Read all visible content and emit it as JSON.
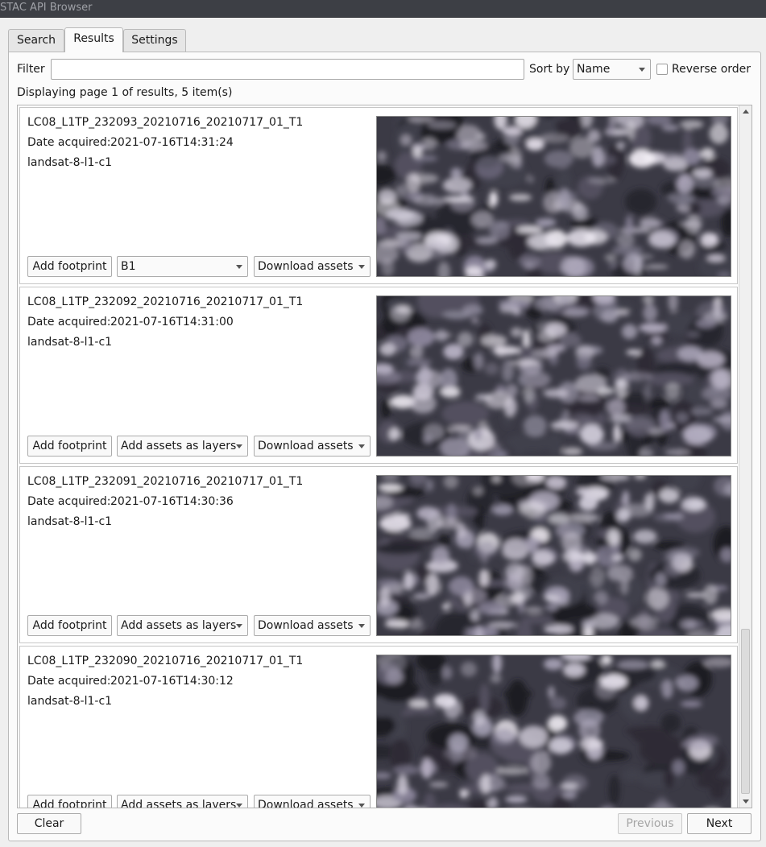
{
  "window": {
    "title": "STAC API Browser"
  },
  "tabs": [
    {
      "label": "Search",
      "active": false
    },
    {
      "label": "Results",
      "active": true
    },
    {
      "label": "Settings",
      "active": false
    }
  ],
  "toolbar": {
    "filter_label": "Filter",
    "filter_value": "",
    "sort_label": "Sort by",
    "sort_value": "Name",
    "reverse_label": "Reverse order",
    "reverse_checked": false
  },
  "status": "Displaying page 1 of results, 5 item(s)",
  "items": [
    {
      "name": "LC08_L1TP_232093_20210716_20210717_01_T1",
      "date_label": "Date acquired:",
      "date": "2021-07-16T14:31:24",
      "collection": "landsat-8-l1-c1",
      "footprint_button": "Add footprint",
      "assets_combo": "B1",
      "download_combo": "Download assets"
    },
    {
      "name": "LC08_L1TP_232092_20210716_20210717_01_T1",
      "date_label": "Date acquired:",
      "date": "2021-07-16T14:31:00",
      "collection": "landsat-8-l1-c1",
      "footprint_button": "Add footprint",
      "assets_combo": "Add assets as layers",
      "download_combo": "Download assets"
    },
    {
      "name": "LC08_L1TP_232091_20210716_20210717_01_T1",
      "date_label": "Date acquired:",
      "date": "2021-07-16T14:30:36",
      "collection": "landsat-8-l1-c1",
      "footprint_button": "Add footprint",
      "assets_combo": "Add assets as layers",
      "download_combo": "Download assets"
    },
    {
      "name": "LC08_L1TP_232090_20210716_20210717_01_T1",
      "date_label": "Date acquired:",
      "date": "2021-07-16T14:30:12",
      "collection": "landsat-8-l1-c1",
      "footprint_button": "Add footprint",
      "assets_combo": "Add assets as layers",
      "download_combo": "Download assets"
    }
  ],
  "footer": {
    "clear_label": "Clear",
    "previous_label": "Previous",
    "previous_enabled": false,
    "next_label": "Next"
  }
}
